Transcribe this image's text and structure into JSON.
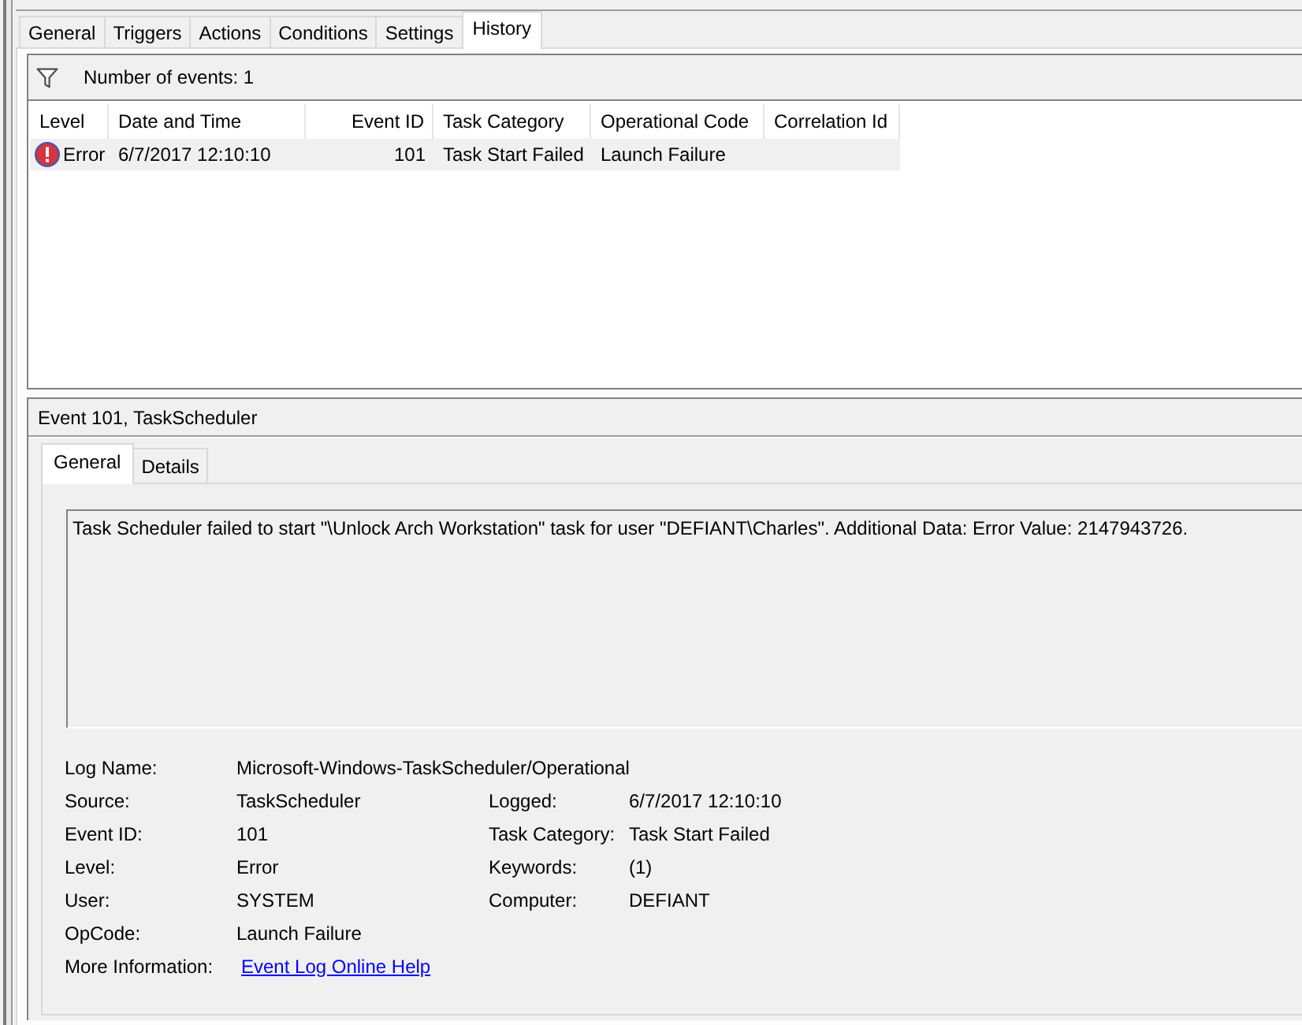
{
  "tabs": [
    {
      "label": "General",
      "selected": false
    },
    {
      "label": "Triggers",
      "selected": false
    },
    {
      "label": "Actions",
      "selected": false
    },
    {
      "label": "Conditions",
      "selected": false
    },
    {
      "label": "Settings",
      "selected": false
    },
    {
      "label": "History",
      "selected": true
    }
  ],
  "history": {
    "event_count": "Number of events: 1",
    "columns": [
      "Level",
      "Date and Time",
      "Event ID",
      "Task Category",
      "Operational Code",
      "Correlation Id"
    ],
    "rows": [
      {
        "kind": "error",
        "level": "Error",
        "date_time": "6/7/2017 12:10:10",
        "event_id": "101",
        "task_category": "Task Start Failed",
        "operational_code": "Launch Failure",
        "selected": true
      }
    ]
  },
  "event_detail": {
    "title": "Event 101, TaskScheduler",
    "tabs": [
      {
        "label": "General",
        "selected": true
      },
      {
        "label": "Details",
        "selected": false
      }
    ],
    "description": "Task Scheduler failed to start \"\\Unlock Arch Workstation\" task for user \"DEFIANT\\Charles\". Additional Data: Error Value: 2147943726.",
    "properties": [
      [
        {
          "kind": "text",
          "label": "Log Name:",
          "value": "Microsoft-Windows-TaskScheduler/Operational"
        }
      ],
      [
        {
          "kind": "text",
          "label": "Source:",
          "value": "TaskScheduler"
        },
        {
          "kind": "text",
          "label": "Logged:",
          "value": "6/7/2017 12:10:10"
        }
      ],
      [
        {
          "kind": "text",
          "label": "Event ID:",
          "value": "101"
        },
        {
          "kind": "text",
          "label": "Task Category:",
          "value": "Task Start Failed"
        }
      ],
      [
        {
          "kind": "text",
          "label": "Level:",
          "value": "Error"
        },
        {
          "kind": "text",
          "label": "Keywords:",
          "value": "(1)"
        }
      ],
      [
        {
          "kind": "text",
          "label": "User:",
          "value": "SYSTEM"
        },
        {
          "kind": "text",
          "label": "Computer:",
          "value": "DEFIANT"
        }
      ],
      [
        {
          "kind": "text",
          "label": "OpCode:",
          "value": "Launch Failure"
        }
      ],
      [
        {
          "kind": "link",
          "label": "More Information:",
          "value": "Event Log Online Help"
        }
      ]
    ]
  }
}
